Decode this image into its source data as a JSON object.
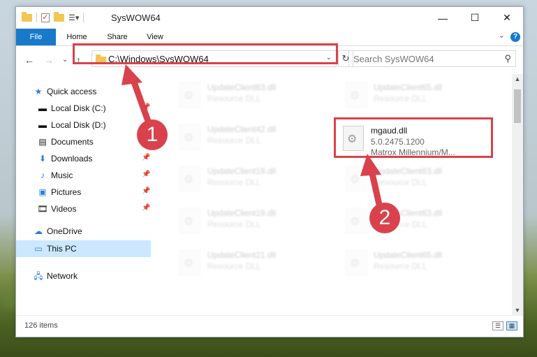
{
  "window": {
    "title": "SysWOW64"
  },
  "ribbon": {
    "tabs": [
      "File",
      "Home",
      "Share",
      "View"
    ],
    "help": "?"
  },
  "address": {
    "path": "C:\\Windows\\SysWOW64"
  },
  "search": {
    "placeholder": "Search SysWOW64"
  },
  "nav": {
    "items": [
      {
        "label": "Quick access",
        "icon": "star-icon"
      },
      {
        "label": "Local Disk (C:)",
        "icon": "drive-icon"
      },
      {
        "label": "Local Disk (D:)",
        "icon": "drive-icon"
      },
      {
        "label": "Documents",
        "icon": "documents-icon"
      },
      {
        "label": "Downloads",
        "icon": "download-icon"
      },
      {
        "label": "Music",
        "icon": "music-icon"
      },
      {
        "label": "Pictures",
        "icon": "pictures-icon"
      },
      {
        "label": "Videos",
        "icon": "video-icon"
      },
      {
        "label": "OneDrive",
        "icon": "cloud-icon"
      },
      {
        "label": "This PC",
        "icon": "computer-icon"
      },
      {
        "label": "Network",
        "icon": "network-icon"
      }
    ]
  },
  "files": {
    "left": [
      {
        "name": "UpdateClient63.dll",
        "type": "Resource DLL"
      },
      {
        "name": "UpdateClient42.dll",
        "type": "Resource DLL"
      },
      {
        "name": "UpdateClient19.dll",
        "type": "Resource DLL"
      },
      {
        "name": "UpdateClient19.dll",
        "type": "Resource DLL"
      },
      {
        "name": "UpdateClient21.dll",
        "type": "Resource DLL"
      }
    ],
    "right": [
      {
        "name": "UpdateClient65.dll",
        "type": "Resource DLL"
      },
      {
        "name": "UpdateClient63.dll",
        "type": "Resource DLL"
      },
      {
        "name": "UpdateClient63.dll",
        "type": "Resource DLL"
      },
      {
        "name": "UpdateClient65.dll",
        "type": "Resource DLL"
      }
    ],
    "highlighted": {
      "name": "mgaud.dll",
      "version": "5.0.2475.1200",
      "description": "Matrox Millennium/M..."
    }
  },
  "status": {
    "count": "126 items"
  },
  "annotations": {
    "step1": "1",
    "step2": "2",
    "color": "#d9424c"
  }
}
